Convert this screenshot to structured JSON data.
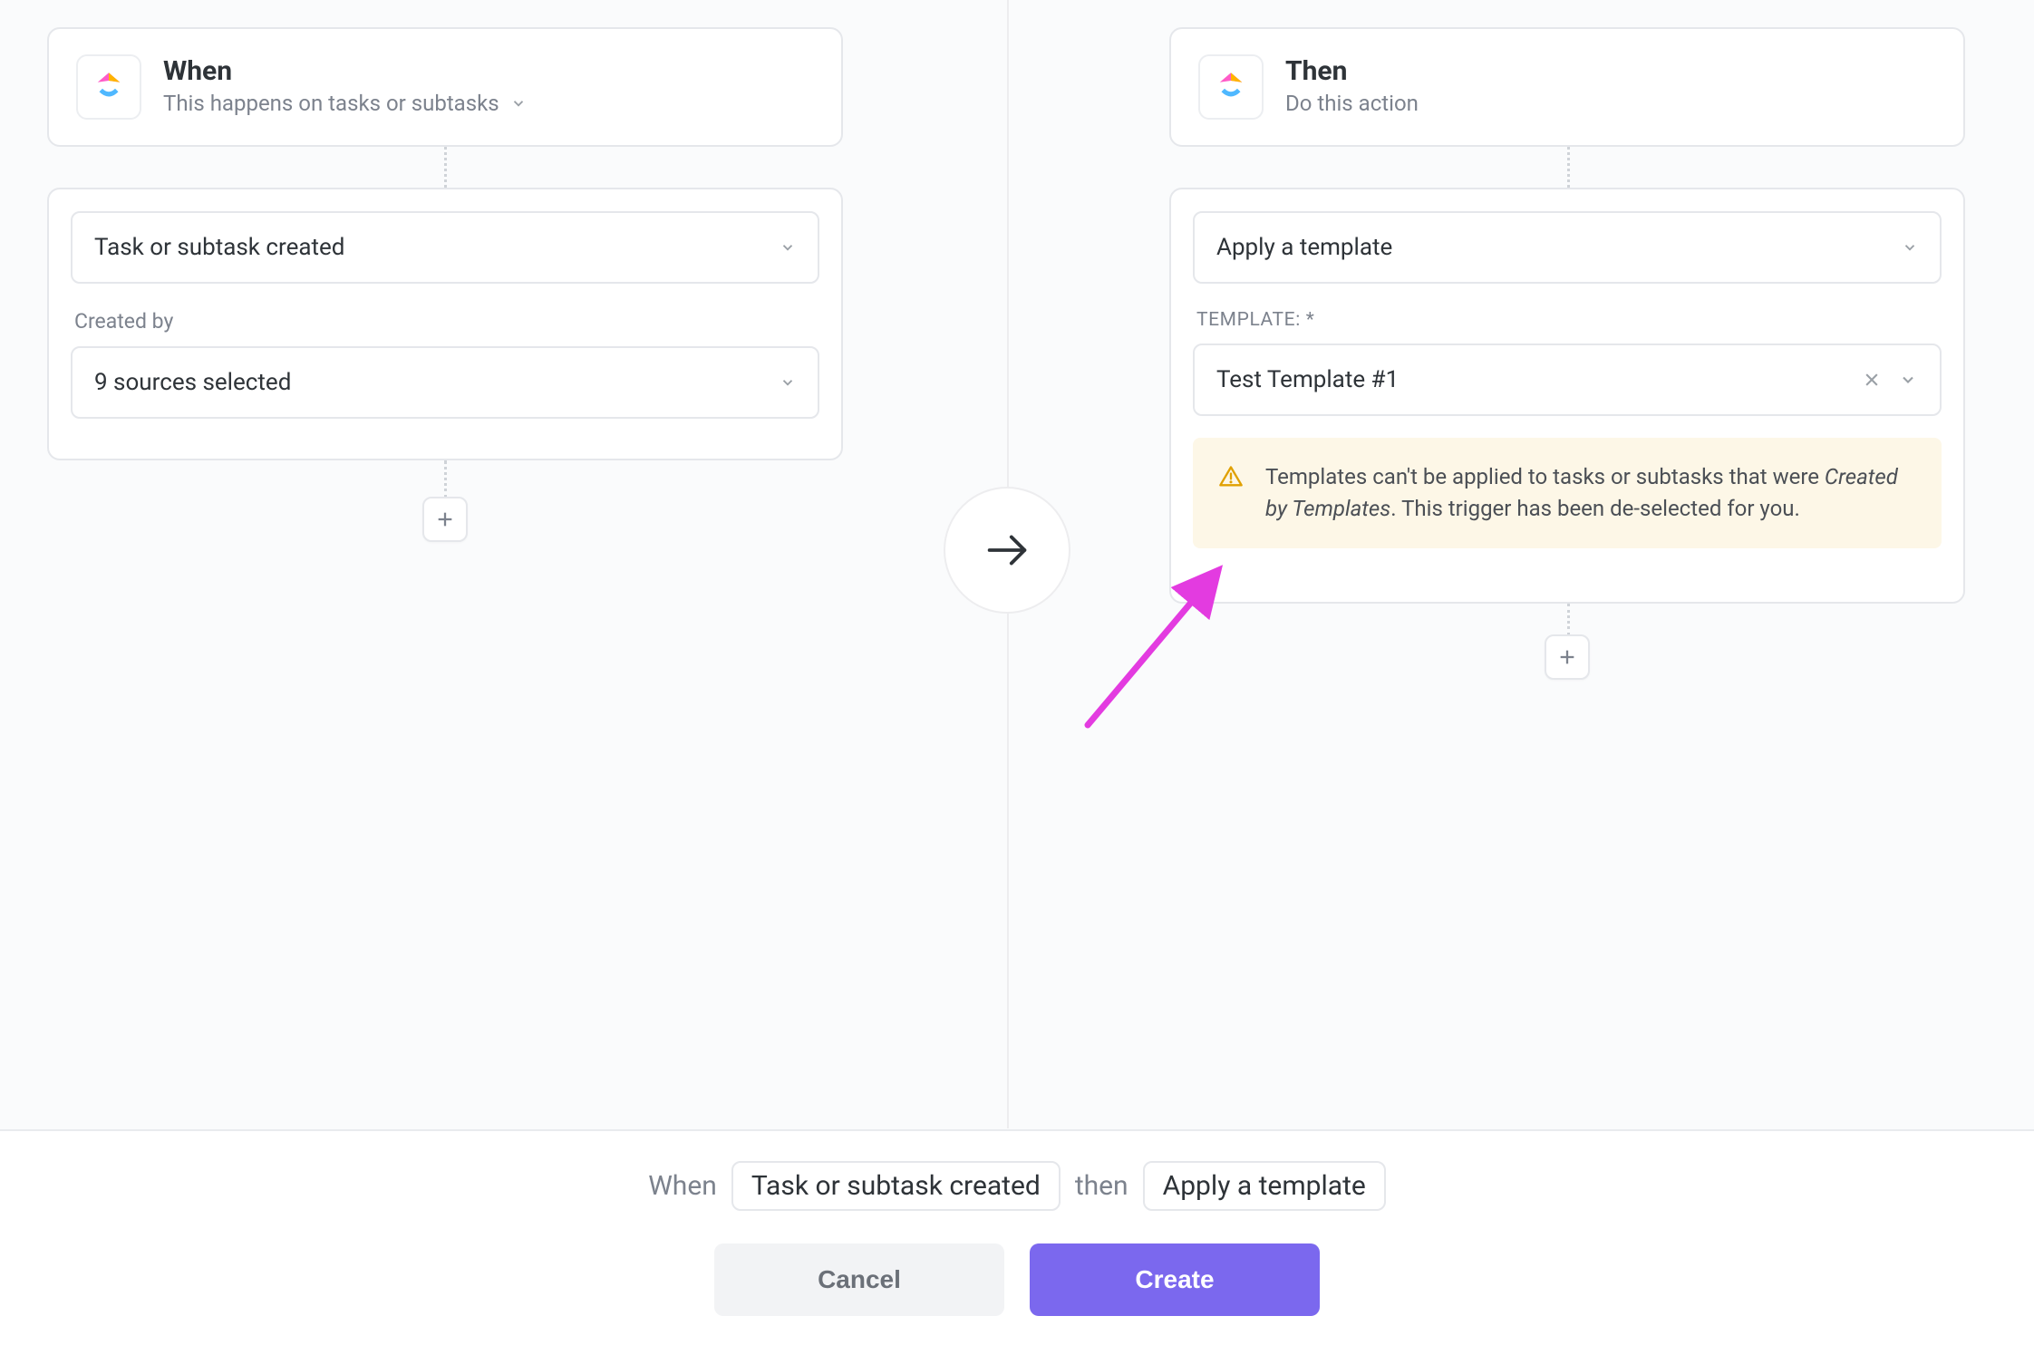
{
  "when": {
    "title": "When",
    "subtitle": "This happens on tasks or subtasks",
    "trigger_value": "Task or subtask created",
    "created_by_label": "Created by",
    "created_by_value": "9 sources selected"
  },
  "then": {
    "title": "Then",
    "subtitle": "Do this action",
    "action_value": "Apply a template",
    "template_label": "TEMPLATE: *",
    "template_value": "Test Template #1",
    "warning_prefix": "Templates can't be applied to tasks or subtasks that were ",
    "warning_em": "Created by Templates",
    "warning_suffix": ". This trigger has been de-selected for you."
  },
  "footer": {
    "summary_when": "When",
    "summary_trigger": "Task or subtask created",
    "summary_then": "then",
    "summary_action": "Apply a template",
    "cancel": "Cancel",
    "create": "Create"
  },
  "icons": {
    "logo": "clickup-logo",
    "chevron_down": "chevron-down",
    "plus": "plus",
    "arrow_right": "arrow-right",
    "close": "close",
    "warning": "warning-triangle"
  }
}
